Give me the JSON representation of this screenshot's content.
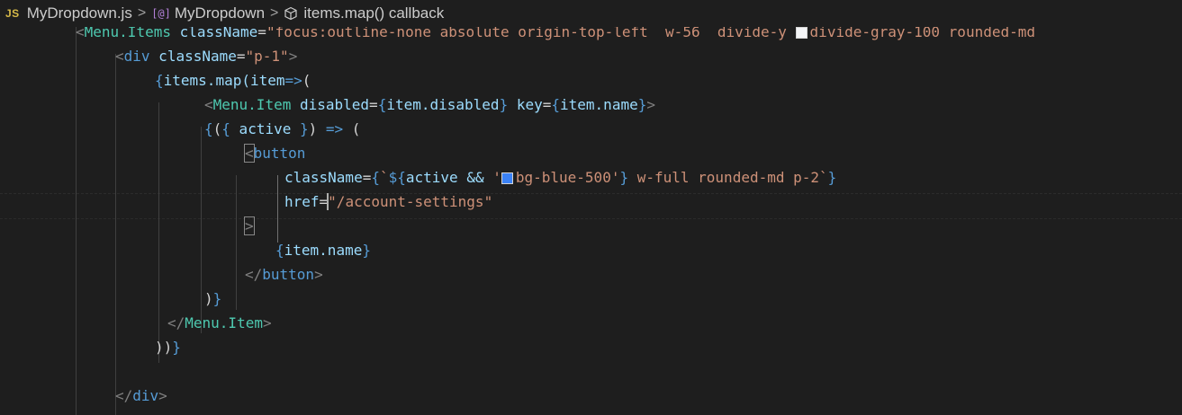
{
  "breadcrumb": {
    "file_icon_text": "JS",
    "file": "MyDropdown.js",
    "symbol_icon_text": "[@]",
    "symbol": "MyDropdown",
    "callback": "items.map() callback",
    "separator": ">"
  },
  "code": {
    "l1": {
      "open": "<",
      "tag": "Menu.Items",
      "attr": " className",
      "eq": "=",
      "str": "\"focus:outline-none absolute origin-top-left  w-56  divide-y ",
      "str2": "divide-gray-100 rounded-md"
    },
    "l2": {
      "open": "<",
      "tag": "div",
      "attr": " className",
      "eq": "=",
      "str": "\"p-1\"",
      "close": ">"
    },
    "l3": {
      "b1": "{",
      "t1": "items.map(item",
      "arrow": "=>",
      "t2": "("
    },
    "l4": {
      "open": "<",
      "tag": "Menu.Item",
      "a1": " disabled",
      "eq1": "=",
      "b1": "{",
      "v1": "item.disabled",
      "b2": "}",
      "a2": " key",
      "eq2": "=",
      "b3": "{",
      "v2": "item.name",
      "b4": "}",
      "close": ">"
    },
    "l5": {
      "b1": "{",
      "t1": "(",
      "b2": "{",
      "t2": " active ",
      "b3": "}",
      "t3": ") ",
      "arrow": "=>",
      "t4": " ("
    },
    "l6": {
      "open": "<",
      "tag": "button"
    },
    "l7": {
      "attr": "className",
      "eq": "=",
      "b1": "{",
      "tick": "`",
      "dollar": "${",
      "t1": "active && ",
      "q1": "'",
      "str": "bg-blue-500'",
      "b2": "}",
      "str2": " w-full rounded-md p-2`",
      "b3": "}"
    },
    "l8": {
      "attr": "href",
      "eq": "=",
      "str": "\"/account-settings\""
    },
    "l9": {
      "close": ">"
    },
    "l10": {
      "b1": "{",
      "t1": "item.name",
      "b2": "}"
    },
    "l11": {
      "open": "</",
      "tag": "button",
      "close": ">"
    },
    "l12": {
      "t1": ")",
      "b1": "}"
    },
    "l13": {
      "open": "</",
      "tag": "Menu.Item",
      "close": ">"
    },
    "l14": {
      "t1": "))",
      "b1": "}"
    },
    "l16": {
      "open": "</",
      "tag": "div",
      "close": ">"
    }
  },
  "colors": {
    "swatch_bg_blue_500": "#3b82f6",
    "swatch_divide_gray_100": "#f3f4f6"
  }
}
